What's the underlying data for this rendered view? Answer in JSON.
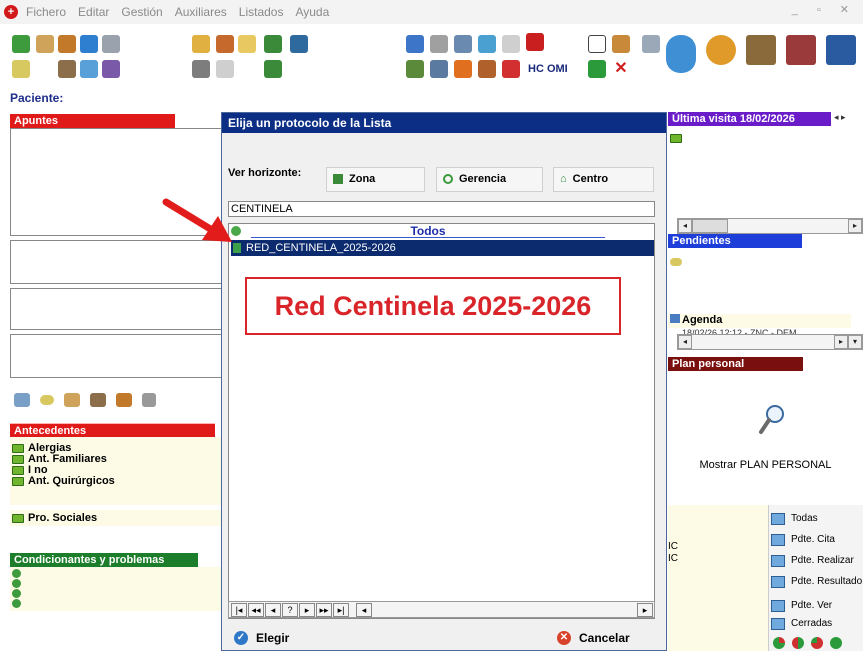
{
  "menu": [
    "Fichero",
    "Editar",
    "Gestión",
    "Auxiliares",
    "Listados",
    "Ayuda"
  ],
  "window_controls": "_ ▫ ✕",
  "toolbar": {
    "hc_omi": "HC OMI"
  },
  "patient_label": "Paciente:",
  "left": {
    "apuntes": "Apuntes",
    "antecedentes": "Antecedentes",
    "antecedentes_items": [
      "Alergias",
      "Ant. Familiares",
      "I no",
      "Ant. Quirúrgicos"
    ],
    "pro_sociales": "Pro. Sociales",
    "condicionantes": "Condicionantes y problemas"
  },
  "dialog": {
    "title": "Elija un protocolo de la Lista",
    "ver_horizonte": "Ver horizonte:",
    "options": [
      "Zona",
      "Gerencia",
      "Centro"
    ],
    "search_value": "CENTINELA",
    "list_header": "Todos",
    "list_items": [
      "RED_CENTINELA_2025-2026"
    ],
    "elegir": "Elegir",
    "cancelar": "Cancelar"
  },
  "annotation": "Red Centinela 2025-2026",
  "right": {
    "ultima_visita": "Última visita 18/02/2026",
    "pendientes": "Pendientes",
    "agenda": "Agenda",
    "agenda_entry": "18/02/26 12:12 - ZNC - DEM",
    "plan_personal": "Plan personal",
    "mostrar_plan": "Mostrar PLAN PERSONAL",
    "filters": [
      "Todas",
      "Pdte. Cita",
      "Pdte. Realizar",
      "Pdte. Resultado",
      "Pdte. Ver",
      "Cerradas"
    ],
    "side_fragments": [
      "IC",
      "IC"
    ]
  },
  "colors": {
    "dialog_title": "#0c2f85",
    "apuntes_header": "#e01919",
    "antecedentes_header": "#e01919",
    "condicionantes_header": "#1c7d2a",
    "ultima_visita_header": "#6a1cc9",
    "pendientes_header": "#1d3ed8",
    "plan_personal_header": "#7a0f0f",
    "callout": "#d9252a"
  }
}
